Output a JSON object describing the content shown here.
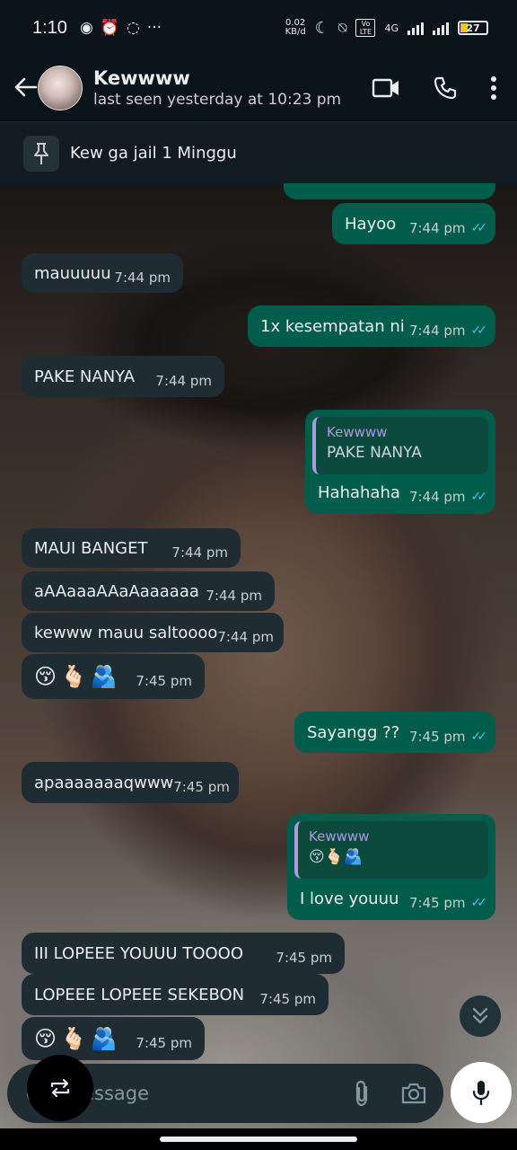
{
  "status_bar": {
    "time": "1:10",
    "net_speed_value": "0.02",
    "net_speed_unit": "KB/d",
    "battery": "27",
    "network": "4G",
    "volte": "Vo LTE"
  },
  "header": {
    "name": "Kewwww",
    "last_seen": "last seen yesterday at 10:23 pm"
  },
  "pinned": {
    "text": "Kew ga jail 1 Minggu"
  },
  "messages": [
    {
      "dir": "out",
      "text": "Hayoo",
      "time": "7:44 pm"
    },
    {
      "dir": "in",
      "text": "mauuuuu",
      "time": "7:44 pm"
    },
    {
      "dir": "out",
      "text": "1x kesempatan ni",
      "time": "7:44 pm"
    },
    {
      "dir": "in",
      "text": "PAKE NANYA",
      "time": "7:44 pm"
    },
    {
      "dir": "out",
      "quote_name": "Kewwww",
      "quote_text": "PAKE NANYA",
      "text": "Hahahaha",
      "time": "7:44 pm"
    },
    {
      "dir": "in",
      "text": "MAUI BANGET",
      "time": "7:44 pm"
    },
    {
      "dir": "in",
      "text": "aAAaaaAAaAaaaaaa",
      "time": "7:44 pm"
    },
    {
      "dir": "in",
      "text": "kewww mauu saltoooo",
      "time": "7:44 pm"
    },
    {
      "dir": "in",
      "text": "😚🫰🏻🫂",
      "time": "7:45 pm"
    },
    {
      "dir": "out",
      "text": "Sayangg ??",
      "time": "7:45 pm"
    },
    {
      "dir": "in",
      "text": "apaaaaaaaqwww",
      "time": "7:45 pm"
    },
    {
      "dir": "out",
      "quote_name": "Kewwww",
      "quote_text": "😚🫰🏻🫂",
      "text": "I love youuu",
      "time": "7:45 pm"
    },
    {
      "dir": "in",
      "text": "III LOPEEE YOUUU TOOOO",
      "time": "7:45 pm"
    },
    {
      "dir": "in",
      "text": "LOPEEE LOPEEE SEKEBON",
      "time": "7:45 pm"
    },
    {
      "dir": "in",
      "text": "😚🫰🏻🫂",
      "time": "7:45 pm"
    }
  ],
  "composer": {
    "placeholder": "Message"
  },
  "colors": {
    "incoming_bubble": "#202c33",
    "outgoing_bubble": "#005c4b",
    "read_ticks": "#53bdeb",
    "header_bg": "#0b141a"
  },
  "icons": [
    "back-arrow-icon",
    "video-call-icon",
    "phone-icon",
    "more-vert-icon",
    "pin-icon",
    "double-check-icon",
    "chevrons-down-icon",
    "emoji-icon",
    "attach-icon",
    "camera-icon",
    "mic-icon",
    "repeat-icon"
  ]
}
